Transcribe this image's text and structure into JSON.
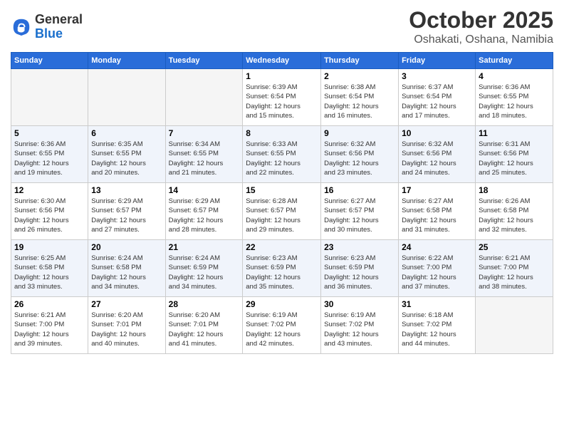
{
  "header": {
    "logo_line1": "General",
    "logo_line2": "Blue",
    "month": "October 2025",
    "location": "Oshakati, Oshana, Namibia"
  },
  "weekdays": [
    "Sunday",
    "Monday",
    "Tuesday",
    "Wednesday",
    "Thursday",
    "Friday",
    "Saturday"
  ],
  "weeks": [
    [
      {
        "num": "",
        "info": ""
      },
      {
        "num": "",
        "info": ""
      },
      {
        "num": "",
        "info": ""
      },
      {
        "num": "1",
        "info": "Sunrise: 6:39 AM\nSunset: 6:54 PM\nDaylight: 12 hours\nand 15 minutes."
      },
      {
        "num": "2",
        "info": "Sunrise: 6:38 AM\nSunset: 6:54 PM\nDaylight: 12 hours\nand 16 minutes."
      },
      {
        "num": "3",
        "info": "Sunrise: 6:37 AM\nSunset: 6:54 PM\nDaylight: 12 hours\nand 17 minutes."
      },
      {
        "num": "4",
        "info": "Sunrise: 6:36 AM\nSunset: 6:55 PM\nDaylight: 12 hours\nand 18 minutes."
      }
    ],
    [
      {
        "num": "5",
        "info": "Sunrise: 6:36 AM\nSunset: 6:55 PM\nDaylight: 12 hours\nand 19 minutes."
      },
      {
        "num": "6",
        "info": "Sunrise: 6:35 AM\nSunset: 6:55 PM\nDaylight: 12 hours\nand 20 minutes."
      },
      {
        "num": "7",
        "info": "Sunrise: 6:34 AM\nSunset: 6:55 PM\nDaylight: 12 hours\nand 21 minutes."
      },
      {
        "num": "8",
        "info": "Sunrise: 6:33 AM\nSunset: 6:55 PM\nDaylight: 12 hours\nand 22 minutes."
      },
      {
        "num": "9",
        "info": "Sunrise: 6:32 AM\nSunset: 6:56 PM\nDaylight: 12 hours\nand 23 minutes."
      },
      {
        "num": "10",
        "info": "Sunrise: 6:32 AM\nSunset: 6:56 PM\nDaylight: 12 hours\nand 24 minutes."
      },
      {
        "num": "11",
        "info": "Sunrise: 6:31 AM\nSunset: 6:56 PM\nDaylight: 12 hours\nand 25 minutes."
      }
    ],
    [
      {
        "num": "12",
        "info": "Sunrise: 6:30 AM\nSunset: 6:56 PM\nDaylight: 12 hours\nand 26 minutes."
      },
      {
        "num": "13",
        "info": "Sunrise: 6:29 AM\nSunset: 6:57 PM\nDaylight: 12 hours\nand 27 minutes."
      },
      {
        "num": "14",
        "info": "Sunrise: 6:29 AM\nSunset: 6:57 PM\nDaylight: 12 hours\nand 28 minutes."
      },
      {
        "num": "15",
        "info": "Sunrise: 6:28 AM\nSunset: 6:57 PM\nDaylight: 12 hours\nand 29 minutes."
      },
      {
        "num": "16",
        "info": "Sunrise: 6:27 AM\nSunset: 6:57 PM\nDaylight: 12 hours\nand 30 minutes."
      },
      {
        "num": "17",
        "info": "Sunrise: 6:27 AM\nSunset: 6:58 PM\nDaylight: 12 hours\nand 31 minutes."
      },
      {
        "num": "18",
        "info": "Sunrise: 6:26 AM\nSunset: 6:58 PM\nDaylight: 12 hours\nand 32 minutes."
      }
    ],
    [
      {
        "num": "19",
        "info": "Sunrise: 6:25 AM\nSunset: 6:58 PM\nDaylight: 12 hours\nand 33 minutes."
      },
      {
        "num": "20",
        "info": "Sunrise: 6:24 AM\nSunset: 6:58 PM\nDaylight: 12 hours\nand 34 minutes."
      },
      {
        "num": "21",
        "info": "Sunrise: 6:24 AM\nSunset: 6:59 PM\nDaylight: 12 hours\nand 34 minutes."
      },
      {
        "num": "22",
        "info": "Sunrise: 6:23 AM\nSunset: 6:59 PM\nDaylight: 12 hours\nand 35 minutes."
      },
      {
        "num": "23",
        "info": "Sunrise: 6:23 AM\nSunset: 6:59 PM\nDaylight: 12 hours\nand 36 minutes."
      },
      {
        "num": "24",
        "info": "Sunrise: 6:22 AM\nSunset: 7:00 PM\nDaylight: 12 hours\nand 37 minutes."
      },
      {
        "num": "25",
        "info": "Sunrise: 6:21 AM\nSunset: 7:00 PM\nDaylight: 12 hours\nand 38 minutes."
      }
    ],
    [
      {
        "num": "26",
        "info": "Sunrise: 6:21 AM\nSunset: 7:00 PM\nDaylight: 12 hours\nand 39 minutes."
      },
      {
        "num": "27",
        "info": "Sunrise: 6:20 AM\nSunset: 7:01 PM\nDaylight: 12 hours\nand 40 minutes."
      },
      {
        "num": "28",
        "info": "Sunrise: 6:20 AM\nSunset: 7:01 PM\nDaylight: 12 hours\nand 41 minutes."
      },
      {
        "num": "29",
        "info": "Sunrise: 6:19 AM\nSunset: 7:02 PM\nDaylight: 12 hours\nand 42 minutes."
      },
      {
        "num": "30",
        "info": "Sunrise: 6:19 AM\nSunset: 7:02 PM\nDaylight: 12 hours\nand 43 minutes."
      },
      {
        "num": "31",
        "info": "Sunrise: 6:18 AM\nSunset: 7:02 PM\nDaylight: 12 hours\nand 44 minutes."
      },
      {
        "num": "",
        "info": ""
      }
    ]
  ]
}
